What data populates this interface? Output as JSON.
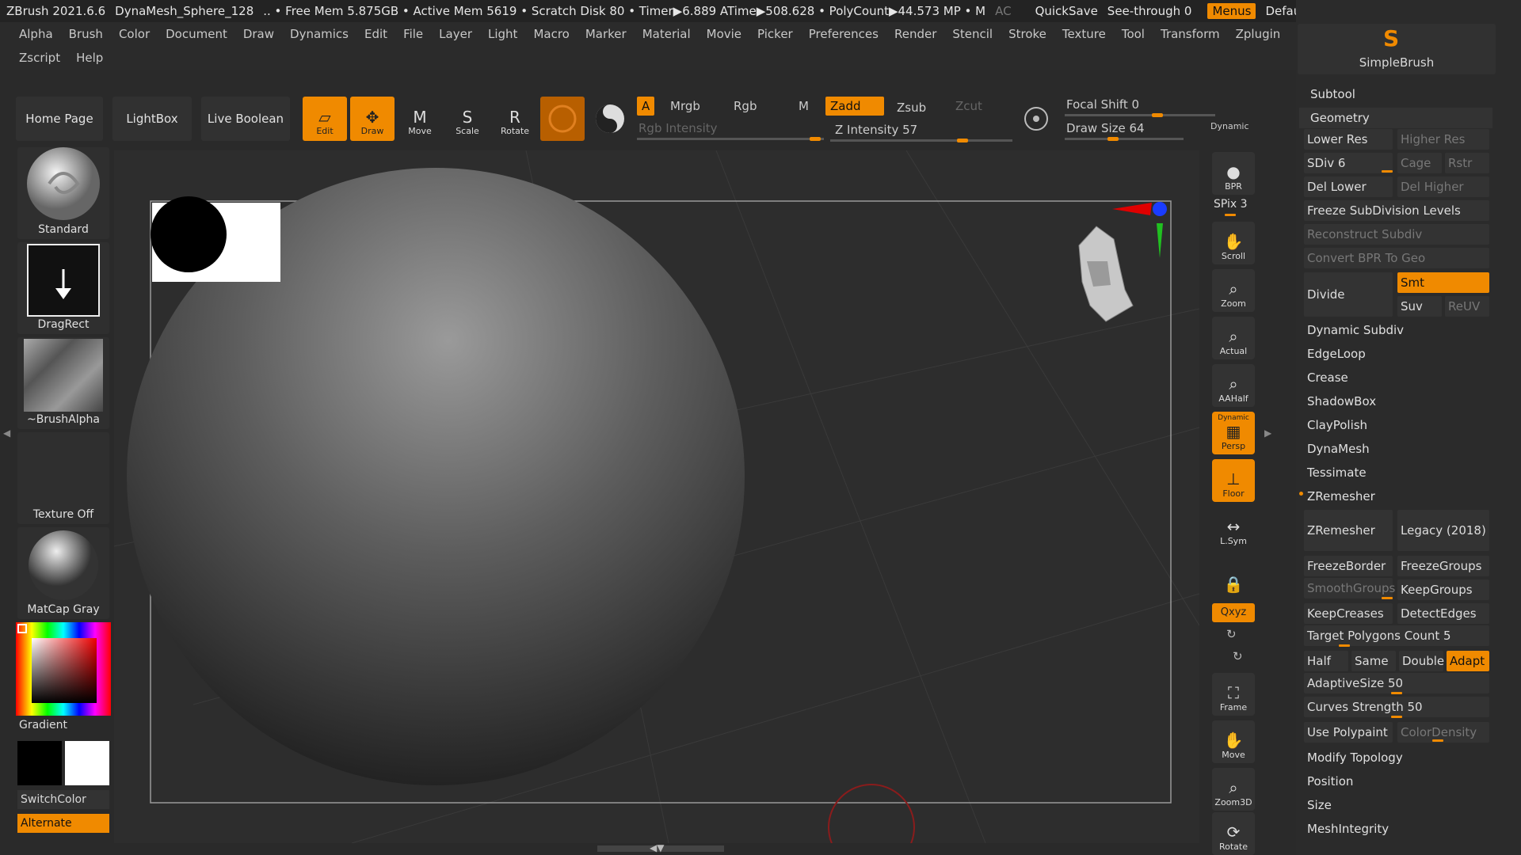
{
  "titlebar": {
    "app": "ZBrush 2021.6.6",
    "document": "DynaMesh_Sphere_128",
    "stats": ".. • Free Mem 5.875GB • Active Mem 5619 • Scratch Disk 80 •  Timer▶6.889 ATime▶508.628 • PolyCount▶44.573 MP  • M",
    "ac": "AC",
    "quicksave": "QuickSave",
    "seethrough": "See-through  0",
    "menus": "Menus",
    "defaultzscript": "DefaultZScript"
  },
  "menu_row1": [
    "Alpha",
    "Brush",
    "Color",
    "Document",
    "Draw",
    "Dynamics",
    "Edit",
    "File",
    "Layer",
    "Light",
    "Macro",
    "Marker",
    "Material",
    "Movie",
    "Picker",
    "Preferences",
    "Render",
    "Stencil",
    "Stroke",
    "Texture",
    "Tool",
    "Transform",
    "Zplugin"
  ],
  "menu_row2": [
    "Zscript",
    "Help"
  ],
  "toolbar": {
    "home": "Home Page",
    "lightbox": "LightBox",
    "liveboolean": "Live Boolean",
    "edit": "Edit",
    "draw": "Draw",
    "move": "Move",
    "scale": "Scale",
    "rotate": "Rotate",
    "a": "A",
    "mrgb": "Mrgb",
    "rgb": "Rgb",
    "m": "M",
    "zadd": "Zadd",
    "zsub": "Zsub",
    "zcut": "Zcut",
    "rgb_intensity": "Rgb Intensity",
    "z_intensity": "Z Intensity 57",
    "focal_shift": "Focal Shift 0",
    "draw_size": "Draw Size 64",
    "dynamic": "Dynamic"
  },
  "shelf": {
    "brush": "Standard",
    "stroke": "DragRect",
    "alpha": "~BrushAlpha",
    "texture": "Texture Off",
    "material": "MatCap Gray",
    "gradient": "Gradient",
    "switchcolor": "SwitchColor",
    "alternate": "Alternate"
  },
  "righttools": {
    "bpr": "BPR",
    "spix": "SPix 3",
    "scroll": "Scroll",
    "zoom": "Zoom",
    "actual": "Actual",
    "aahalf": "AAHalf",
    "persp": "Persp",
    "persp_top": "Dynamic",
    "floor": "Floor",
    "lsym": "L.Sym",
    "xyz": "Qxyz",
    "frame": "Frame",
    "move": "Move",
    "zoom3d": "Zoom3D",
    "rotate": "Rotate"
  },
  "panel": {
    "simplebrush": "SimpleBrush",
    "subtool": "Subtool",
    "geometry": "Geometry",
    "lower_res": "Lower Res",
    "higher_res": "Higher Res",
    "sdiv": "SDiv 6",
    "cage": "Cage",
    "rstr": "Rstr",
    "del_lower": "Del Lower",
    "del_higher": "Del Higher",
    "freeze_subdiv": "Freeze SubDivision Levels",
    "reconstruct": "Reconstruct Subdiv",
    "convert_bpr": "Convert BPR To Geo",
    "divide": "Divide",
    "smt": "Smt",
    "suv": "Suv",
    "reuv": "ReUV",
    "dynamic_subdiv": "Dynamic Subdiv",
    "edgeloop": "EdgeLoop",
    "crease": "Crease",
    "shadowbox": "ShadowBox",
    "claypolish": "ClayPolish",
    "dynamesh": "DynaMesh",
    "tessimate": "Tessimate",
    "zremesher_hdr": "ZRemesher",
    "zremesher_btn": "ZRemesher",
    "legacy": "Legacy (2018)",
    "freezeborder": "FreezeBorder",
    "freezegroups": "FreezeGroups",
    "smoothgroups": "SmoothGroups",
    "keepgroups": "KeepGroups",
    "keepcreases": "KeepCreases",
    "detectedges": "DetectEdges",
    "target_poly": "Target Polygons Count 5",
    "half": "Half",
    "same": "Same",
    "double": "Double",
    "adapt": "Adapt",
    "adaptivesize": "AdaptiveSize 50",
    "curves_strength": "Curves Strength 50",
    "use_polypaint": "Use Polypaint",
    "colordensity": "ColorDensity",
    "modify_topology": "Modify Topology",
    "position": "Position",
    "size": "Size",
    "meshintegrity": "MeshIntegrity"
  },
  "colors": {
    "accent": "#f08a00",
    "bg": "#2a2a2a"
  }
}
